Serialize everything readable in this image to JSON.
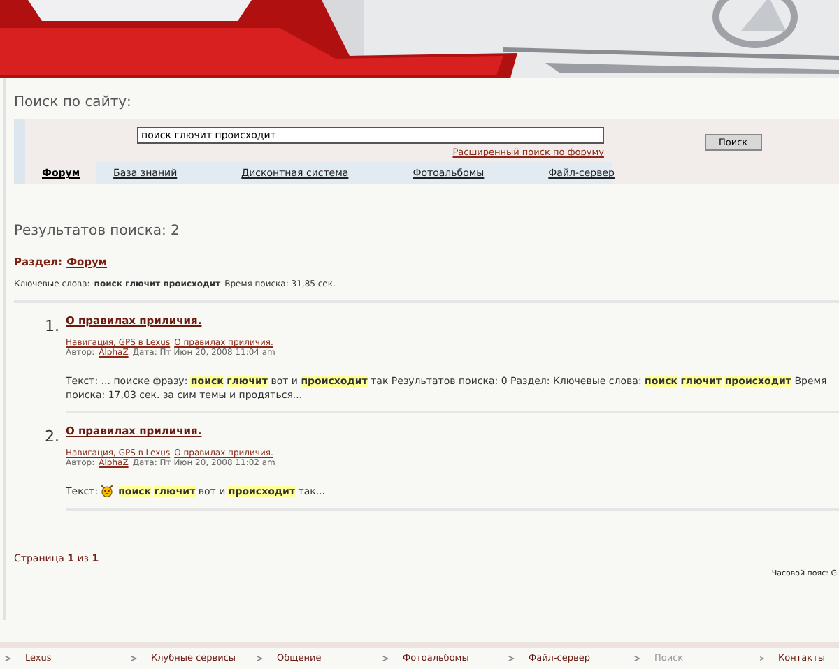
{
  "search": {
    "title": "Поиск по сайту:",
    "value": "поиск глючит происходит",
    "advanced_link": "Расширенный  поиск по форуму",
    "button": "Поиск"
  },
  "tabs": [
    {
      "label": "Форум",
      "selected": true
    },
    {
      "label": "База знаний",
      "selected": false
    },
    {
      "label": "Дисконтная система",
      "selected": false
    },
    {
      "label": "Фотоальбомы",
      "selected": false
    },
    {
      "label": "Файл-сервер",
      "selected": false
    }
  ],
  "results_heading": "Результатов поиска: 2",
  "section": {
    "label": "Раздел:",
    "link": "Форум"
  },
  "keywords": {
    "label": "Ключевые слова:",
    "words": "поиск глючит происходит",
    "time": "Время поиска: 31,85 сек."
  },
  "results": [
    {
      "number": "1.",
      "title": "О правилах приличия.",
      "forum": "Навигация, GPS в Lexus",
      "topic": "О правилах приличия.",
      "author_label": "Автор:",
      "author": "AlphaZ",
      "date": "Дата: Пт Июн 20, 2008 11:04 am",
      "text": [
        {
          "kind": "plain",
          "text": "Текст: ... поиске фразу:"
        },
        {
          "kind": "highlight",
          "text": "поиск"
        },
        {
          "kind": "highlight",
          "text": "глючит"
        },
        {
          "kind": "plain",
          "text": "вот и"
        },
        {
          "kind": "highlight",
          "text": "происходит"
        },
        {
          "kind": "plain",
          "text": "так Результатов поиска: 0 Раздел: Ключевые слова:"
        },
        {
          "kind": "highlight",
          "text": "поиск"
        },
        {
          "kind": "highlight",
          "text": "глючит"
        },
        {
          "kind": "highlight",
          "text": "происходит"
        },
        {
          "kind": "plain",
          "text": "Время поиска: 17,03 сек. за сим темы и продяться..."
        }
      ]
    },
    {
      "number": "2.",
      "title": "О правилах приличия.",
      "forum": "Навигация, GPS в Lexus",
      "topic": "О правилах приличия.",
      "author_label": "Автор:",
      "author": "AlphaZ",
      "date": "Дата: Пт Июн 20, 2008 11:02 am",
      "text": [
        {
          "kind": "plain",
          "text": "Текст:"
        },
        {
          "kind": "smiley"
        },
        {
          "kind": "highlight",
          "text": "поиск"
        },
        {
          "kind": "highlight",
          "text": "глючит"
        },
        {
          "kind": "plain",
          "text": "вот и"
        },
        {
          "kind": "highlight",
          "text": "происходит"
        },
        {
          "kind": "plain",
          "text": "так..."
        }
      ]
    }
  ],
  "pagination": "Страница **1** из **1**",
  "timezone": "Часовой пояс: Gl",
  "footer": [
    {
      "label": "Lexus",
      "selected": false
    },
    {
      "label": "Клубные сервисы",
      "selected": false
    },
    {
      "label": "Общение",
      "selected": false
    },
    {
      "label": "Фотоальбомы",
      "selected": false
    },
    {
      "label": "Файл-сервер",
      "selected": false
    },
    {
      "label": "Поиск",
      "selected": true
    },
    {
      "label": "Контакты",
      "selected": false
    }
  ]
}
